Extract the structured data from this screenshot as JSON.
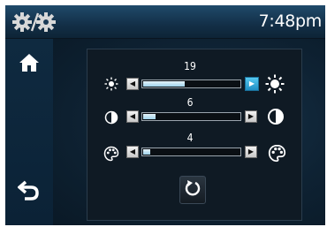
{
  "header": {
    "clock": "7:48pm",
    "settings_icon": "settings-gears-icon"
  },
  "sidebar": {
    "items": [
      {
        "name": "home",
        "icon": "home-icon"
      },
      {
        "name": "back",
        "icon": "back-icon"
      }
    ]
  },
  "panel": {
    "rows": [
      {
        "name": "brightness",
        "value": "19",
        "level": 0.44,
        "left_icon": "sun-small-icon",
        "right_icon": "sun-large-icon",
        "increase_active": true
      },
      {
        "name": "contrast",
        "value": "6",
        "level": 0.14,
        "left_icon": "contrast-icon",
        "right_icon": "contrast-icon",
        "increase_active": false
      },
      {
        "name": "color",
        "value": "4",
        "level": 0.09,
        "left_icon": "color-palette-icon",
        "right_icon": "color-palette-icon",
        "increase_active": false
      }
    ],
    "reset_icon": "reset-icon"
  },
  "colors": {
    "accent": "#2aa6dc",
    "background": "#0b1622"
  }
}
